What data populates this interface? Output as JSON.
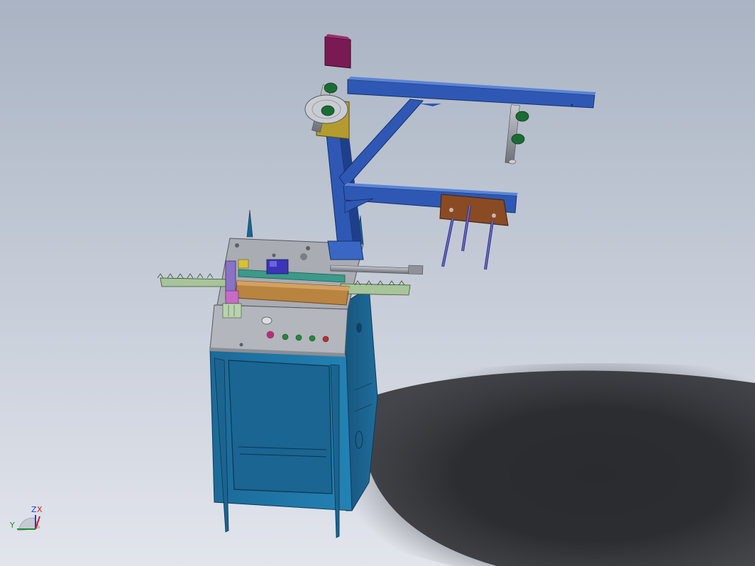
{
  "viewport": {
    "background_top": "#a9b3c3",
    "background_bottom": "#e2e5ec",
    "shadow_color": "#2a2b2f"
  },
  "model": {
    "frame_color": "#2e58b4",
    "cabinet_color": "#1d6f9c",
    "motor_color": "#7a1a52",
    "motor_plate_color": "#b39b2e",
    "mount_block_color": "#8a4a24",
    "fixture_color": "#a7c49a",
    "wood_rail_color": "#b9843f",
    "ring_color": "#1c6b34"
  },
  "triad": {
    "z_label": "Z",
    "x_label": "X",
    "y_label": "Y",
    "z_color": "#1e40c8",
    "x_color": "#d41f1f",
    "y_color": "#1a8f2e"
  }
}
